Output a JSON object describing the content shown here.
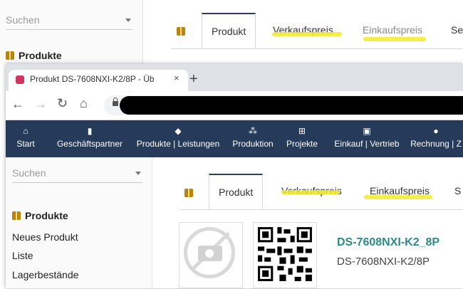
{
  "background": {
    "sidebar": {
      "search_placeholder": "Suchen",
      "section_title": "Produkte"
    },
    "tabs": [
      "Produkt",
      "Verkaufspreis",
      "Einkaufspreis",
      "Se"
    ]
  },
  "browser": {
    "tab_title": "Produkt DS-7608NXI-K2/8P - Üb",
    "tab_close": "×",
    "new_tab": "+"
  },
  "nav": {
    "items": [
      {
        "label": "Start",
        "icon": "home-icon",
        "glyph": "⌂"
      },
      {
        "label": "Geschäftspartner",
        "icon": "building-icon",
        "glyph": "▮"
      },
      {
        "label": "Produkte | Leistungen",
        "icon": "box-icon",
        "glyph": "◆"
      },
      {
        "label": "Produktion",
        "icon": "cubes-icon",
        "glyph": "⁂"
      },
      {
        "label": "Projekte",
        "icon": "sitemap-icon",
        "glyph": "⊞"
      },
      {
        "label": "Einkauf | Vertrieb",
        "icon": "briefcase-icon",
        "glyph": "▣"
      },
      {
        "label": "Rechnung | Z",
        "icon": "coins-icon",
        "glyph": "●"
      }
    ]
  },
  "sidebar": {
    "search_placeholder": "Suchen",
    "section_title": "Produkte",
    "links": [
      "Neues Produkt",
      "Liste",
      "Lagerbestände"
    ]
  },
  "tabs": [
    "Produkt",
    "Verkaufspreis",
    "Einkaufspreis",
    "S"
  ],
  "product": {
    "code": "DS-7608NXI-K2_8P",
    "name": "DS-7608NXI-K2/8P"
  },
  "colors": {
    "nav_bg": "#263a59",
    "highlight": "#f3ea2a",
    "product_code": "#2a8a8a"
  }
}
